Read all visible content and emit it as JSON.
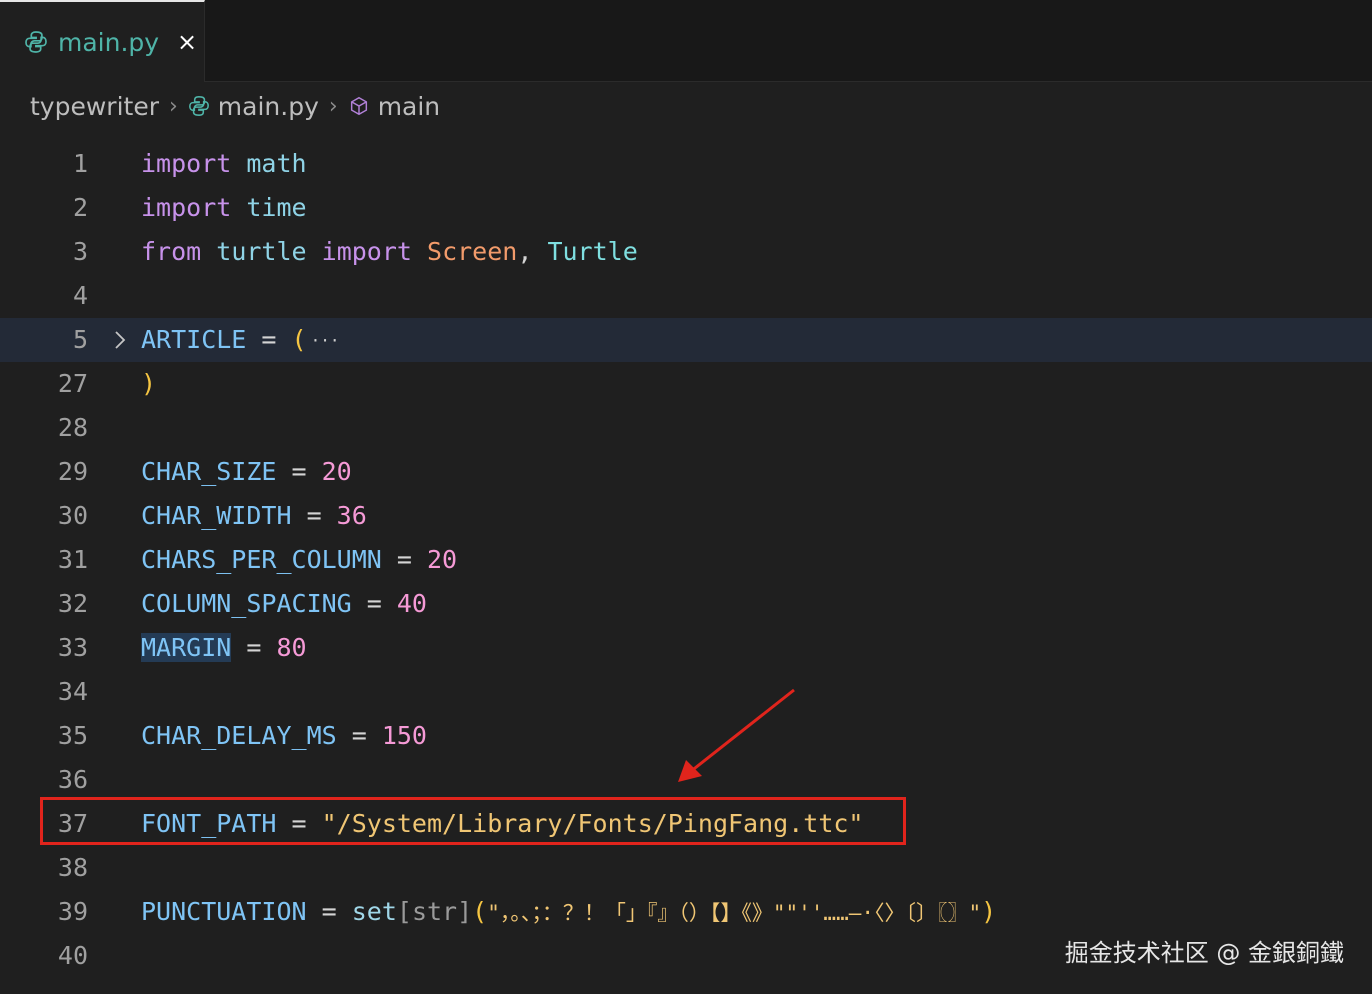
{
  "tab": {
    "label": "main.py",
    "close": "×"
  },
  "breadcrumb": {
    "folder": "typewriter",
    "file": "main.py",
    "symbol": "main"
  },
  "lines": {
    "l1": {
      "no": "1",
      "t1": "import",
      "t2": " ",
      "t3": "math"
    },
    "l2": {
      "no": "2",
      "t1": "import",
      "t2": " ",
      "t3": "time"
    },
    "l3": {
      "no": "3",
      "t1": "from",
      "t2": " ",
      "t3": "turtle",
      "t4": " ",
      "t5": "import",
      "t6": " ",
      "t7": "Screen",
      "t8": ", ",
      "t9": "Turtle"
    },
    "l4": {
      "no": "4"
    },
    "l5": {
      "no": "5",
      "t1": "ARTICLE",
      "t2": " = ",
      "t3": "(",
      "t4": "···"
    },
    "l27": {
      "no": "27",
      "t1": ")"
    },
    "l28": {
      "no": "28"
    },
    "l29": {
      "no": "29",
      "t1": "CHAR_SIZE",
      "t2": " = ",
      "t3": "20"
    },
    "l30": {
      "no": "30",
      "t1": "CHAR_WIDTH",
      "t2": " = ",
      "t3": "36"
    },
    "l31": {
      "no": "31",
      "t1": "CHARS_PER_COLUMN",
      "t2": " = ",
      "t3": "20"
    },
    "l32": {
      "no": "32",
      "t1": "COLUMN_SPACING",
      "t2": " = ",
      "t3": "40"
    },
    "l33": {
      "no": "33",
      "t1": "MARGIN",
      "t2": " = ",
      "t3": "80"
    },
    "l34": {
      "no": "34"
    },
    "l35": {
      "no": "35",
      "t1": "CHAR_DELAY_MS",
      "t2": " = ",
      "t3": "150"
    },
    "l36": {
      "no": "36"
    },
    "l37": {
      "no": "37",
      "t1": "FONT_PATH",
      "t2": " = ",
      "t3": "\"/System/Library/Fonts/PingFang.ttc\""
    },
    "l38": {
      "no": "38"
    },
    "l39": {
      "no": "39",
      "t1": "PUNCTUATION",
      "t2": " = ",
      "t3": "set",
      "t4": "[str]",
      "t5": "(",
      "t6": "\"，。、；：？！「」『』（）【】《》\"\"''……—·〈〉〔〕〖〗\"",
      "t7": ")"
    },
    "l40": {
      "no": "40"
    }
  },
  "watermark": "掘金技术社区 @ 金銀銅鐵",
  "colors": {
    "annotation_red": "#e0241c",
    "tab_label": "#4fb4a8",
    "keyword": "#c792ea",
    "constant": "#7fc4f5",
    "number": "#f59ad6",
    "string": "#f0c674"
  },
  "icons": [
    "python-icon",
    "close-icon",
    "chevron-right-icon",
    "symbol-method-icon",
    "fold-chevron-icon",
    "annotation-arrow"
  ]
}
